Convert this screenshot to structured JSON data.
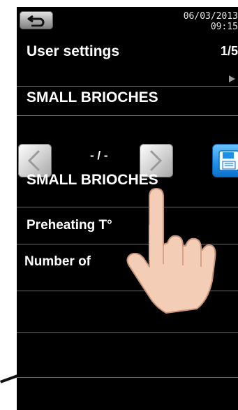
{
  "header": {
    "date": "06/03/2013",
    "time": "09:15",
    "title": "User settings",
    "page_indicator": "1/5"
  },
  "program": {
    "name": "SMALL BRIOCHES",
    "navigator_value": "- / -",
    "selected_name": "SMALL BRIOCHES"
  },
  "settings": {
    "preheating_label": "Preheating T°",
    "number_label": "Number of"
  },
  "colors": {
    "background": "#000000",
    "text": "#ffffff",
    "save_accent": "#1d8fe8"
  },
  "icons": {
    "back": "back-arrow-icon",
    "prev": "chevron-left-icon",
    "next": "chevron-right-icon",
    "save": "floppy-disk-icon",
    "pointer": "hand-pointer-icon"
  }
}
